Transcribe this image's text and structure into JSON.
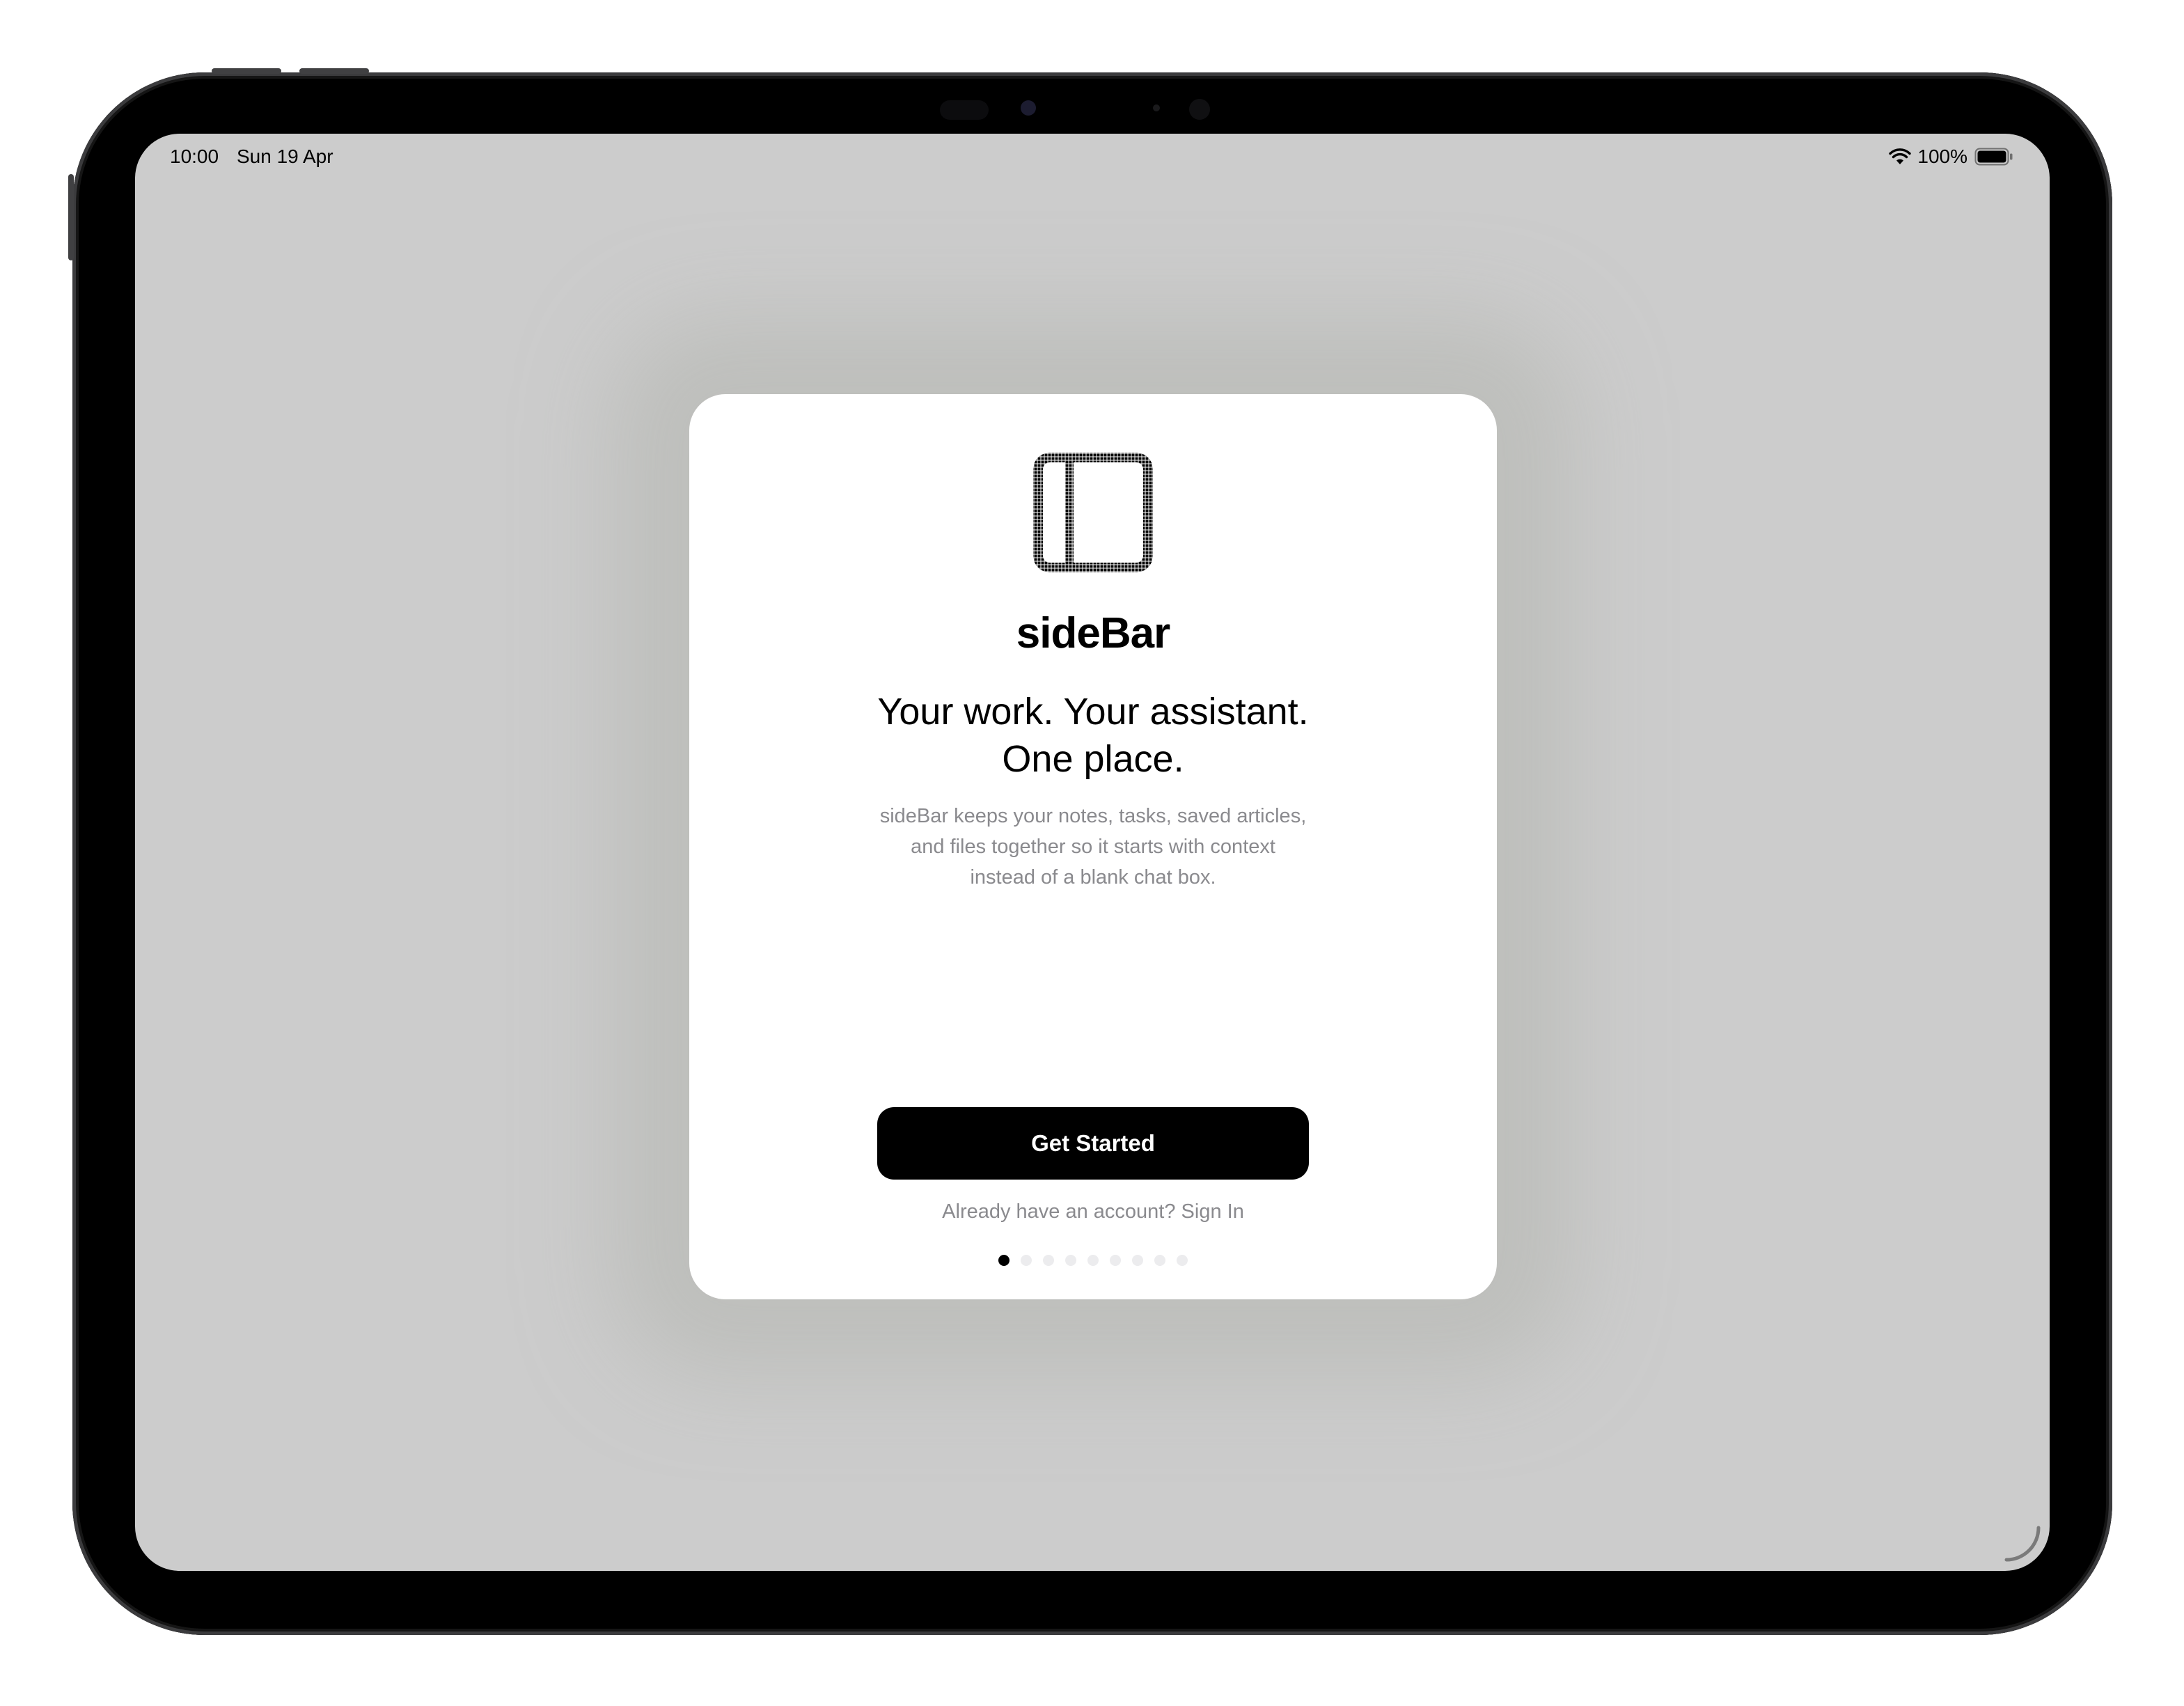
{
  "status_bar": {
    "time": "10:00",
    "date": "Sun 19 Apr",
    "battery_percent": "100%",
    "wifi_icon": "wifi-icon",
    "battery_icon": "battery-full-icon"
  },
  "onboarding": {
    "logo_icon": "sidebar-panel-icon",
    "app_name": "sideBar",
    "tagline_line1": "Your work. Your assistant.",
    "tagline_line2": "One place.",
    "description": "sideBar keeps your notes, tasks, saved articles, and files together so it starts with context instead of a blank chat box.",
    "cta_label": "Get Started",
    "signin_text": "Already have an account? Sign In",
    "page_count": 9,
    "current_page": 1
  },
  "colors": {
    "screen_background": "#cccccc",
    "card_background": "#ffffff",
    "primary_button": "#000000",
    "secondary_text": "#8a8a8e",
    "dot_inactive": "#ececee",
    "dot_active": "#000000"
  }
}
